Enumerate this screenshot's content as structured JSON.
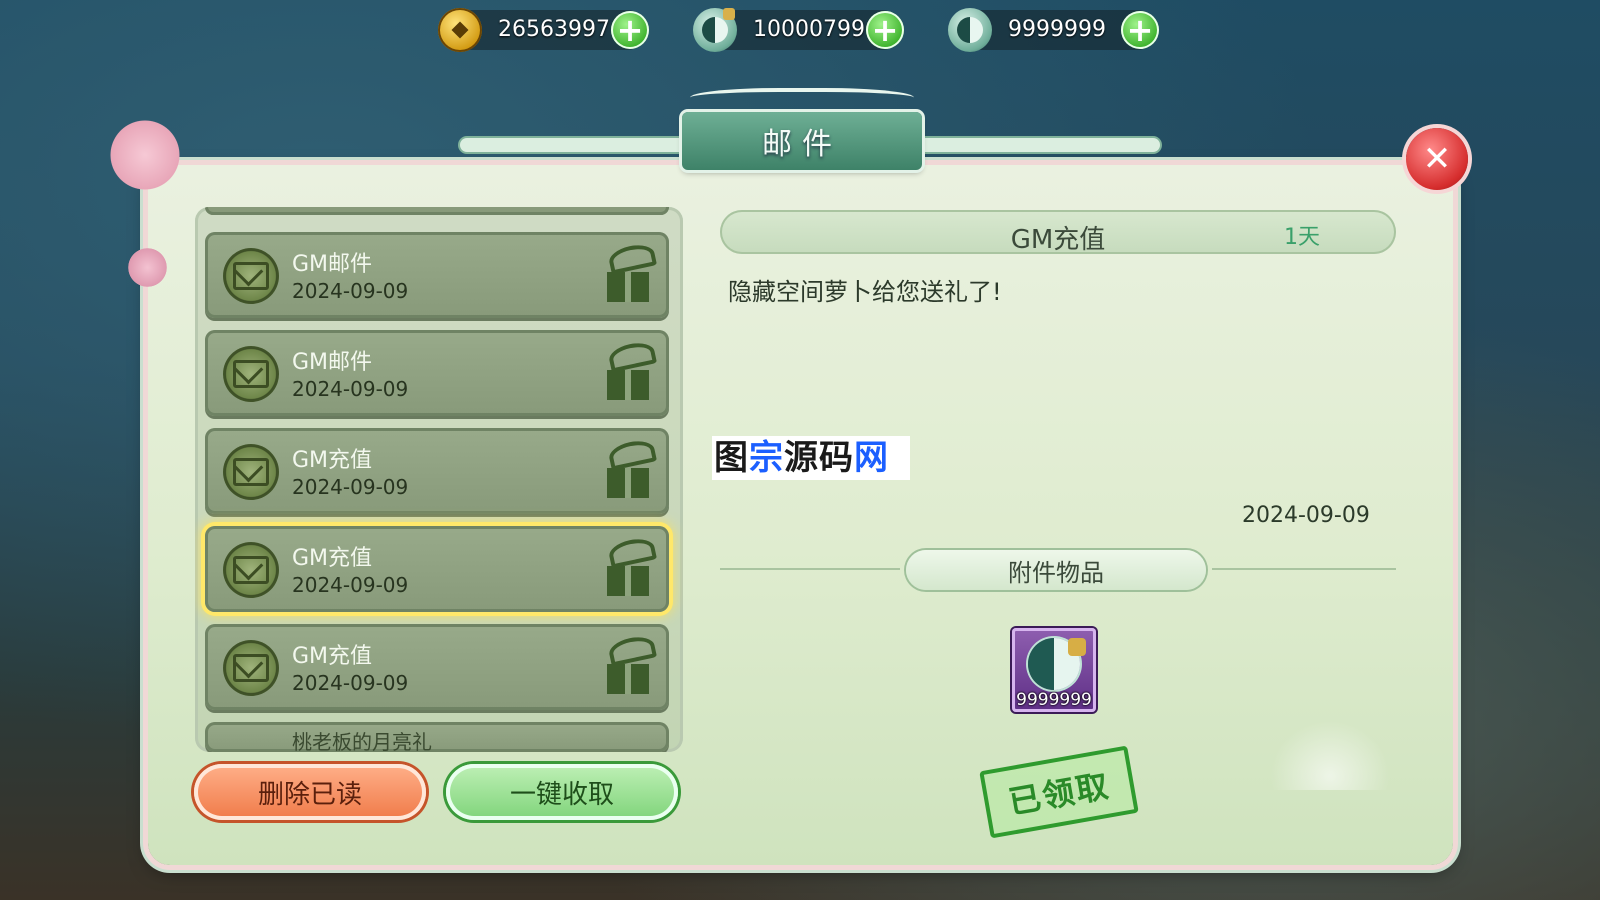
{
  "currencies": [
    {
      "icon": "gold-coin-icon",
      "value": "26563997"
    },
    {
      "icon": "locked-yinyang-icon",
      "value": "10000799"
    },
    {
      "icon": "yinyang-icon",
      "value": "9999999"
    }
  ],
  "window": {
    "title": "邮件"
  },
  "mail_list": [
    {
      "title": "GM邮件",
      "date": "2024-09-09",
      "selected": false
    },
    {
      "title": "GM邮件",
      "date": "2024-09-09",
      "selected": false
    },
    {
      "title": "GM充值",
      "date": "2024-09-09",
      "selected": false
    },
    {
      "title": "GM充值",
      "date": "2024-09-09",
      "selected": true
    },
    {
      "title": "GM充值",
      "date": "2024-09-09",
      "selected": false
    },
    {
      "title": "桃老板的月亮礼",
      "date": "",
      "selected": false
    }
  ],
  "buttons": {
    "delete_read": "删除已读",
    "collect_all": "一键收取"
  },
  "detail": {
    "title": "GM充值",
    "days_left": "1天",
    "body": "隐藏空间萝卜给您送礼了!",
    "date": "2024-09-09",
    "attachments_label": "附件物品",
    "attachment": {
      "icon": "locked-yinyang-item-icon",
      "quantity": "9999999"
    },
    "claimed_stamp": "已领取"
  },
  "watermark": {
    "part1": "图",
    "part2": "宗",
    "part3": "源码",
    "part4": "网"
  },
  "colors": {
    "accent_green": "#3e8268",
    "selected_glow": "#ffe86a",
    "close_red": "#d52c2c"
  }
}
